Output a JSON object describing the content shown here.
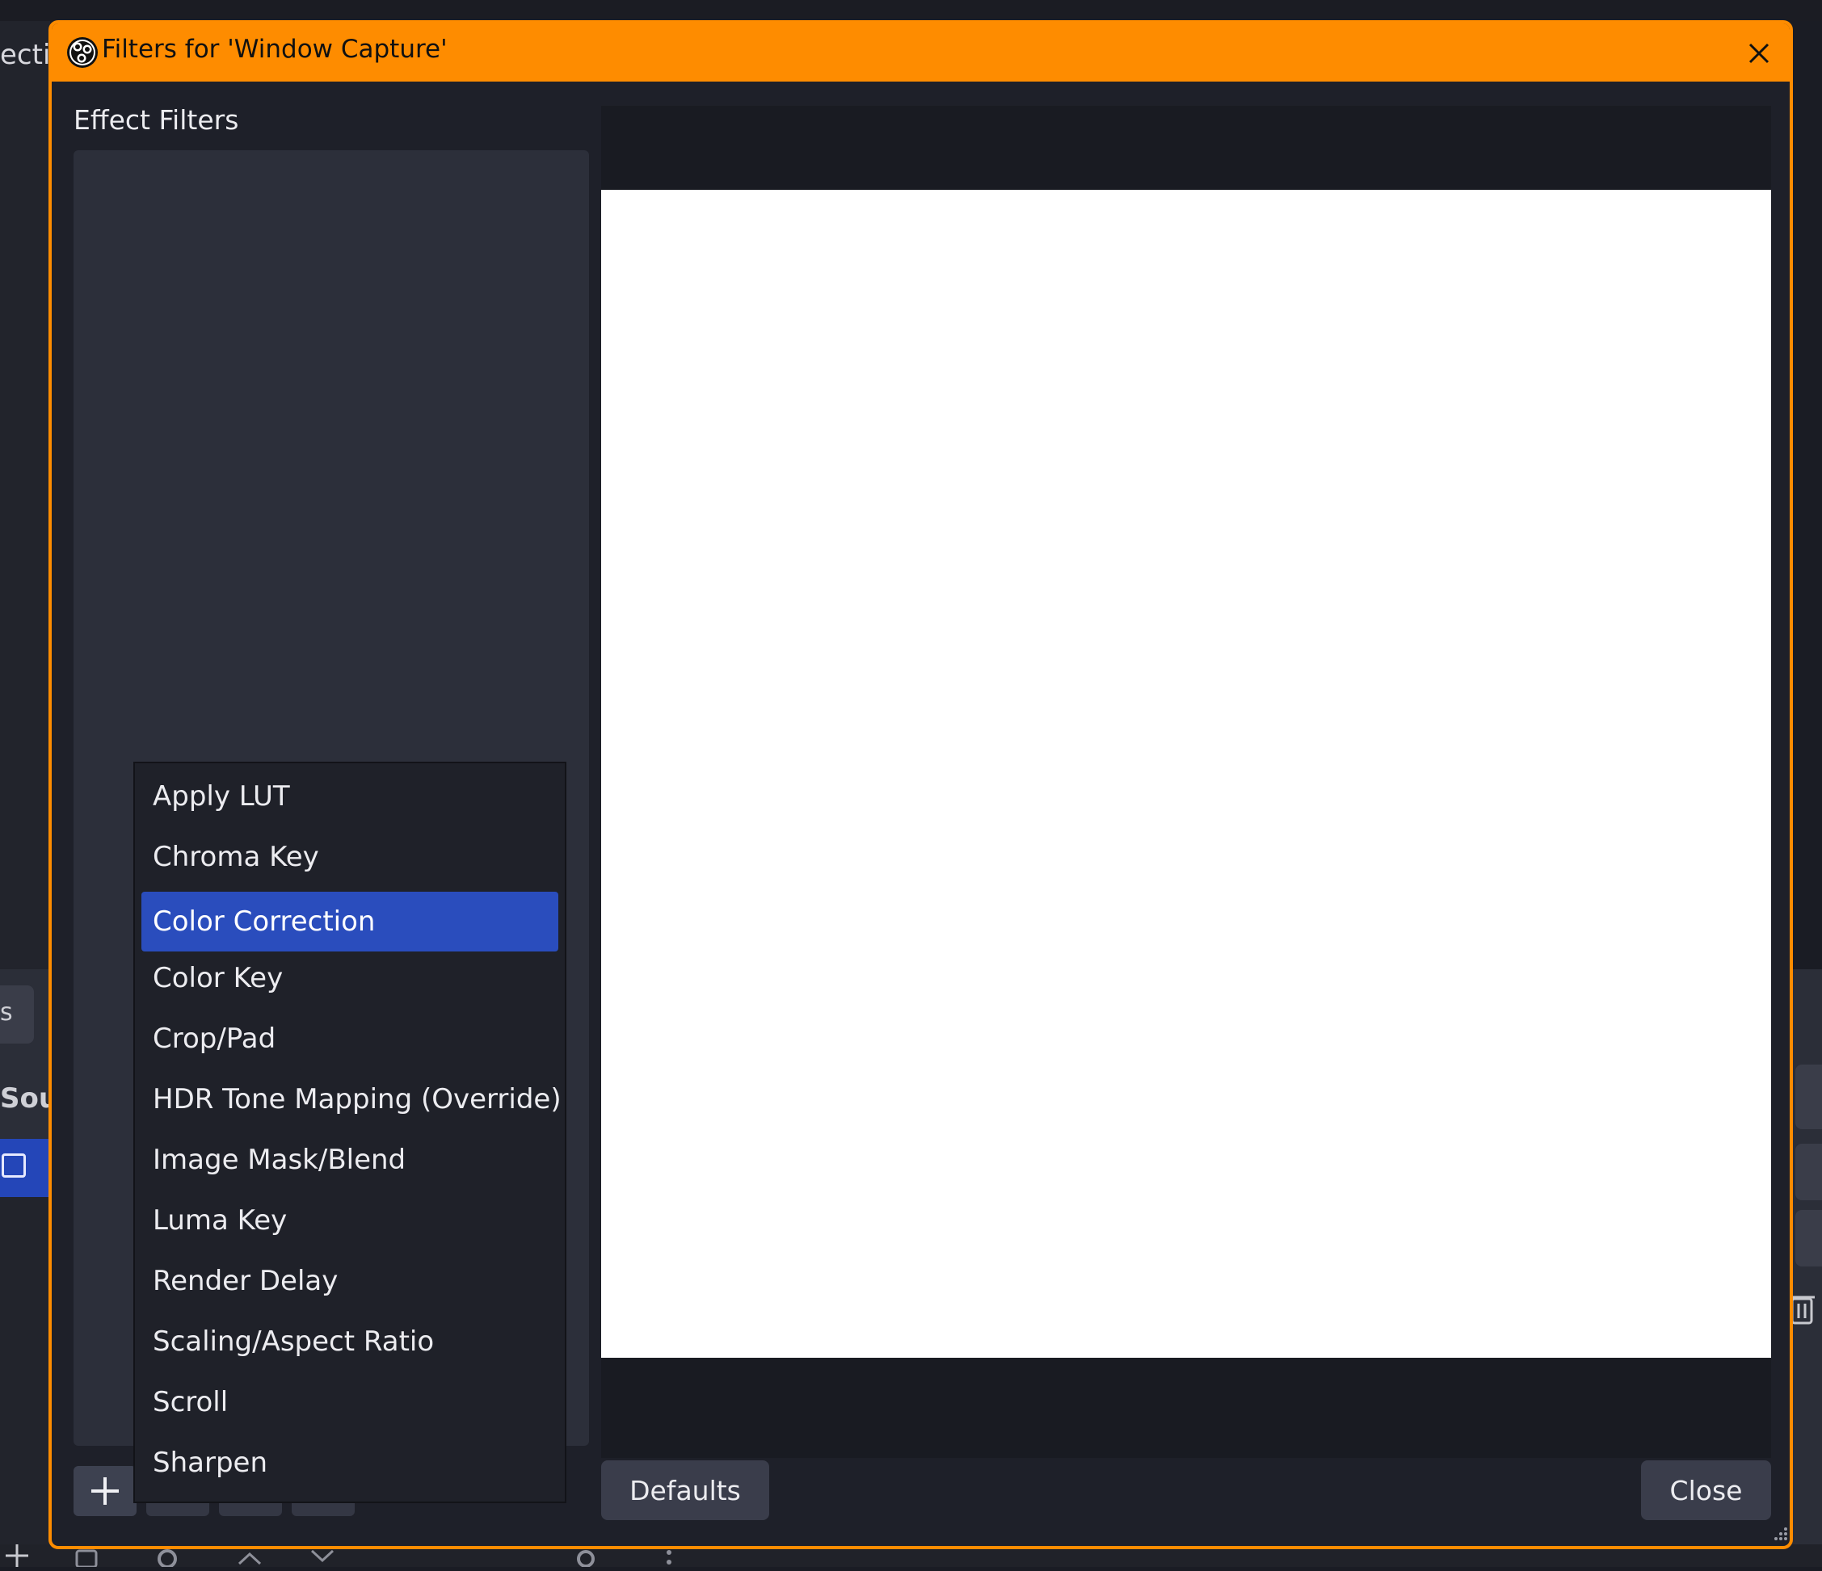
{
  "background": {
    "scene_fragment": "ectio",
    "tab_fragment": "s",
    "sources_fragment": "Sou"
  },
  "dialog": {
    "title": "Filters for 'Window Capture'",
    "effect_filters_label": "Effect Filters",
    "defaults_label": "Defaults",
    "close_label": "Close"
  },
  "menu": {
    "items": [
      {
        "label": "Apply LUT"
      },
      {
        "label": "Chroma Key"
      },
      {
        "label": "Color Correction",
        "selected": true
      },
      {
        "label": "Color Key"
      },
      {
        "label": "Crop/Pad"
      },
      {
        "label": "HDR Tone Mapping (Override)"
      },
      {
        "label": "Image Mask/Blend"
      },
      {
        "label": "Luma Key"
      },
      {
        "label": "Render Delay"
      },
      {
        "label": "Scaling/Aspect Ratio"
      },
      {
        "label": "Scroll"
      },
      {
        "label": "Sharpen"
      }
    ]
  },
  "colors": {
    "accent": "#fe8c00",
    "selection": "#2a4dbd",
    "dialog_bg": "#1e2029"
  }
}
